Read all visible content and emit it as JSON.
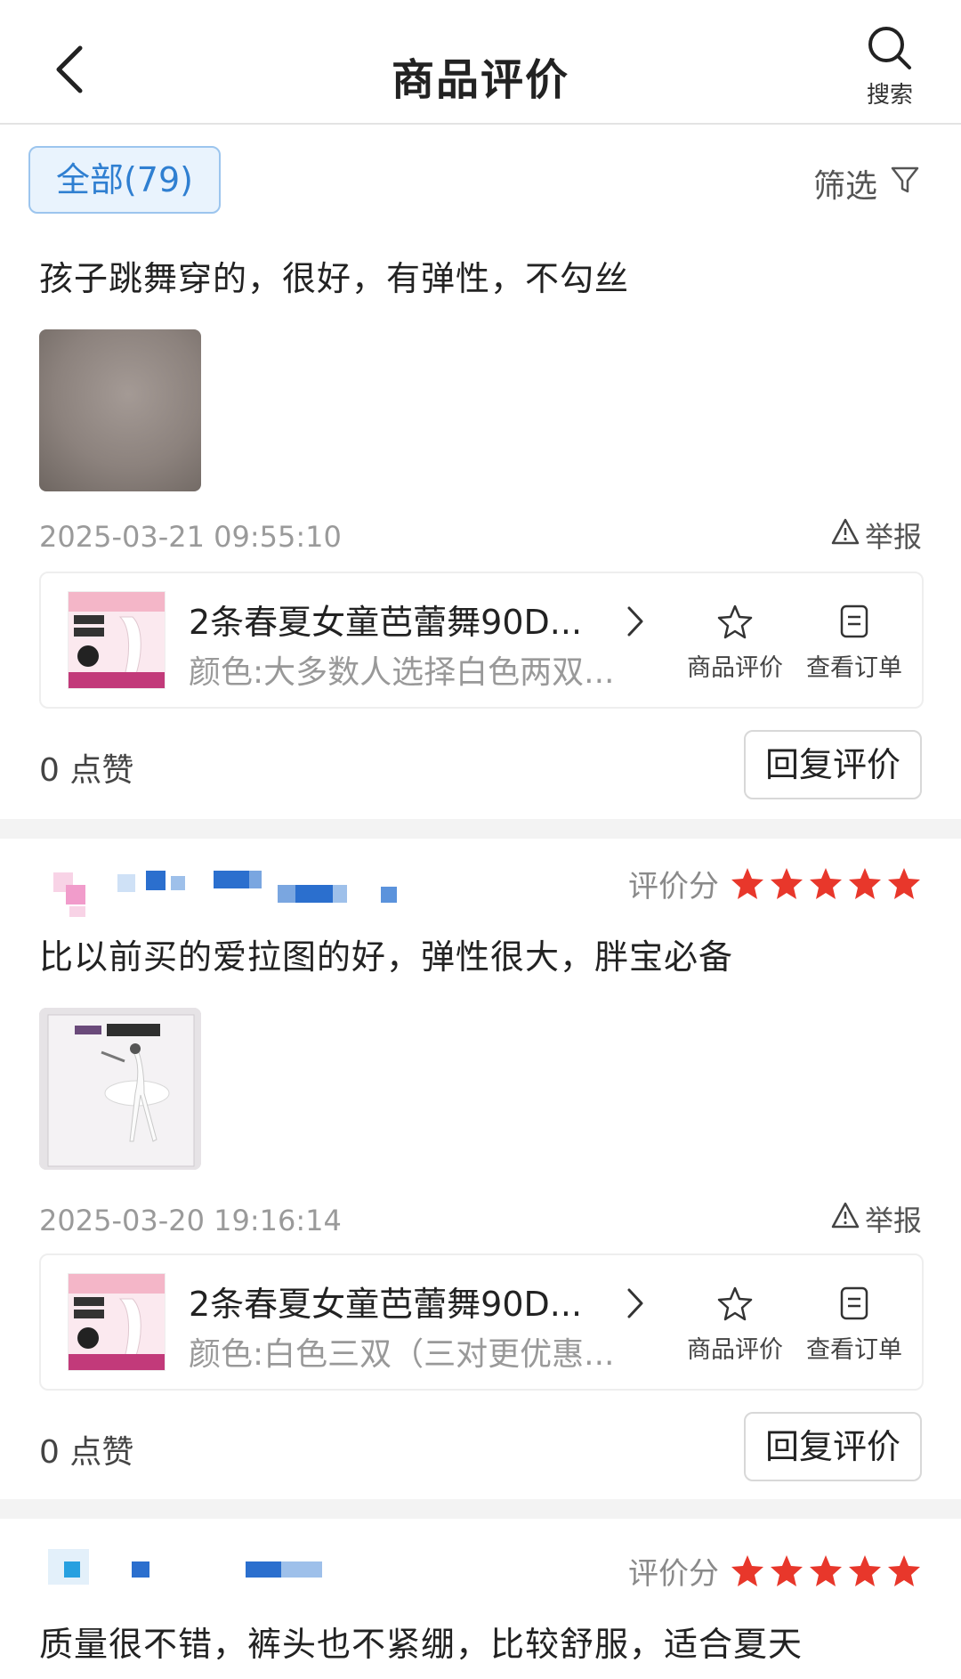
{
  "header": {
    "title": "商品评价",
    "search_label": "搜索"
  },
  "filterbar": {
    "all_tab": "全部(79)",
    "filter_label": "筛选"
  },
  "reviews": [
    {
      "content": "孩子跳舞穿的，很好，有弹性，不勾丝",
      "date": "2025-03-21 09:55:10",
      "report_label": "举报",
      "product": {
        "name": "2条春夏女童芭蕾舞90D...",
        "variant": "颜色:大多数人选择白色两双...",
        "rate_label": "商品评价",
        "order_label": "查看订单"
      },
      "likes": "0 点赞",
      "reply_label": "回复评价"
    },
    {
      "score_label": "评价分",
      "rating": 5,
      "content": "比以前买的爱拉图的好，弹性很大，胖宝必备",
      "date": "2025-03-20 19:16:14",
      "report_label": "举报",
      "product": {
        "name": "2条春夏女童芭蕾舞90D...",
        "variant": "颜色:白色三双（三对更优惠...",
        "rate_label": "商品评价",
        "order_label": "查看订单"
      },
      "likes": "0 点赞",
      "reply_label": "回复评价"
    },
    {
      "score_label": "评价分",
      "rating": 5,
      "content": "质量很不错，裤头也不紧绷，比较舒服，适合夏天"
    }
  ],
  "colors": {
    "accent_blue": "#2f7fd1",
    "star_red": "#e8372b",
    "divider": "#f3f3f3"
  },
  "icons": [
    "back-arrow-icon",
    "search-icon",
    "filter-funnel-icon",
    "warning-icon",
    "chevron-right-icon",
    "star-outline-icon",
    "order-doc-icon",
    "star-filled-icon"
  ]
}
